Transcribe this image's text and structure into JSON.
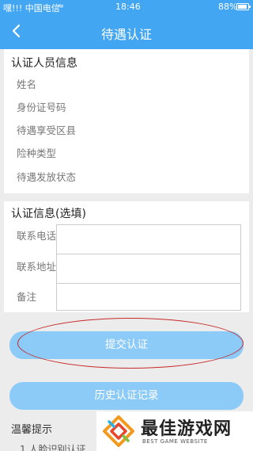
{
  "status_bar": {
    "carrier": "嘿!!! 中国电信",
    "time": "18:46",
    "battery": "88%"
  },
  "nav": {
    "title": "待遇认证"
  },
  "personal_info": {
    "title": "认证人员信息",
    "rows": [
      "姓名",
      "身份证号码",
      "待遇享受区县",
      "险种类型",
      "待遇发放状态"
    ]
  },
  "auth_info": {
    "title": "认证信息(选填)",
    "fields": [
      {
        "label": "联系电话",
        "value": ""
      },
      {
        "label": "联系地址",
        "value": ""
      },
      {
        "label": "备注",
        "value": ""
      }
    ]
  },
  "buttons": {
    "submit": "提交认证",
    "history": "历史认证记录"
  },
  "tips": {
    "title": "温馨提示",
    "line1": "1.人脸识别认证"
  },
  "watermark": {
    "title": "最佳游戏网",
    "subtitle": "BEST GAME WEBSITE"
  },
  "colors": {
    "primary": "#43a6f2",
    "button": "#8ccaf7",
    "highlight_ring": "#c82a2a"
  }
}
